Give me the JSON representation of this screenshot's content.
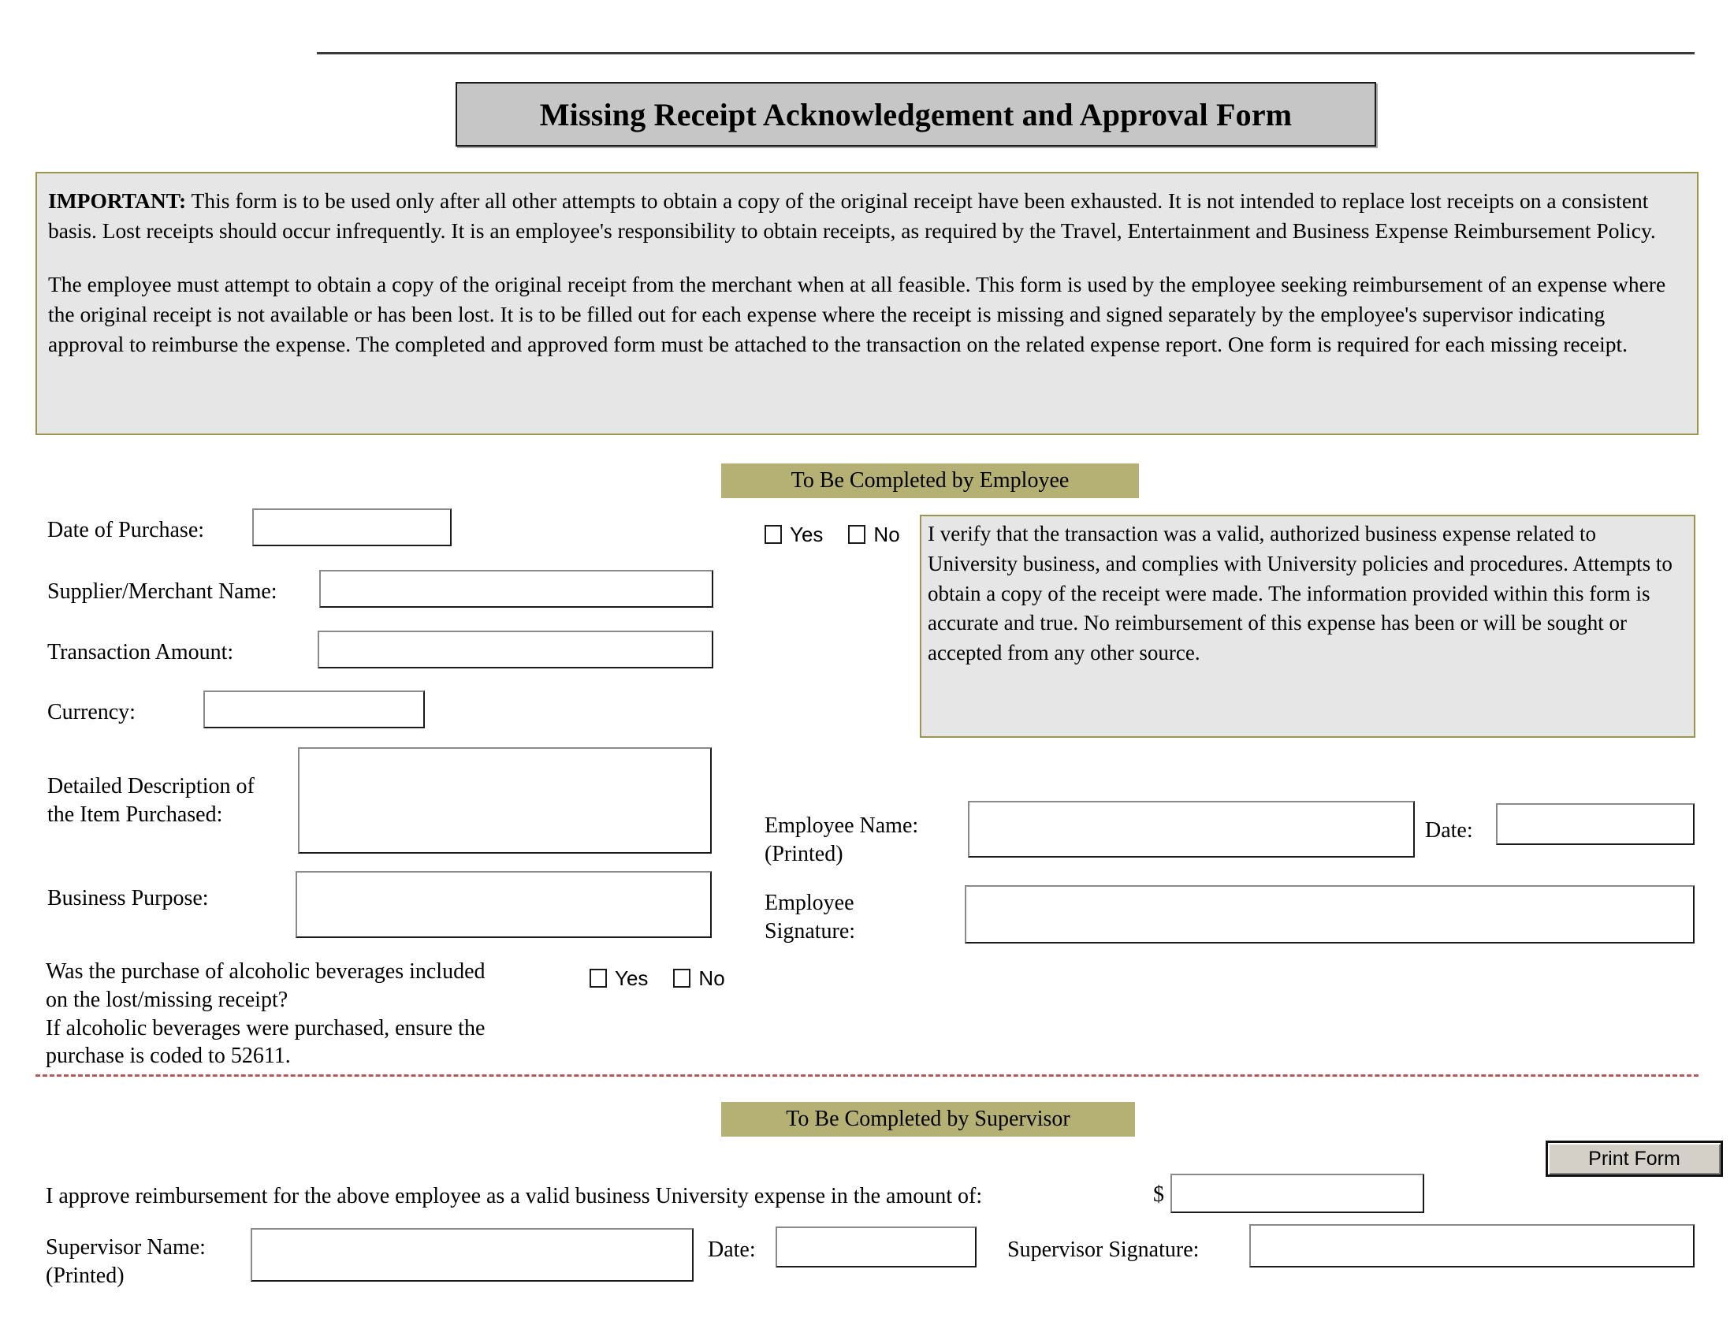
{
  "document": {
    "title": "Missing Receipt Acknowledgement and Approval Form"
  },
  "notice": {
    "lead": "IMPORTANT:",
    "paragraph1": " This form is to be used only after all other attempts to obtain a copy of the original receipt have been exhausted. It is not intended to replace lost receipts on a consistent basis. Lost receipts should occur infrequently. It is an employee's responsibility to obtain receipts, as required by the Travel, Entertainment and Business Expense Reimbursement Policy.",
    "paragraph2": "The employee must attempt to obtain a copy of the original receipt from the merchant when at all feasible.  This form is used by the employee seeking reimbursement of an expense where the original receipt is not available or has been lost.  It is to be filled out for each expense where the receipt is missing and signed separately by the employee's supervisor indicating approval to reimburse the expense.  The completed and approved form must be attached to the transaction on the related expense report.  One form is required for each missing receipt."
  },
  "employee_section": {
    "banner": "To Be Completed by Employee",
    "fields": {
      "date_of_purchase_label": "Date of Purchase:",
      "date_of_purchase_value": "",
      "supplier_label": "Supplier/Merchant Name:",
      "supplier_value": "",
      "transaction_amount_label": "Transaction Amount:",
      "transaction_amount_value": "",
      "currency_label": "Currency:",
      "currency_value": "",
      "detailed_description_label_line1": "Detailed Description of",
      "detailed_description_label_line2": "the Item Purchased:",
      "detailed_description_value": "",
      "business_purpose_label": "Business Purpose:",
      "business_purpose_value": "",
      "employee_name_label_line1": "Employee Name:",
      "employee_name_label_line2": "(Printed)",
      "employee_name_value": "",
      "employee_date_label": "Date:",
      "employee_date_value": "",
      "employee_signature_label_line1": "Employee",
      "employee_signature_label_line2": "Signature:",
      "employee_signature_value": ""
    },
    "verification": {
      "yes_label": "Yes",
      "no_label": "No",
      "statement": "I verify that the transaction was a valid, authorized business expense related to University business, and complies with University policies and procedures. Attempts to obtain a copy of the receipt were made. The information provided within this form is accurate and true. No reimbursement of this expense has been or will be sought or accepted from any other source."
    },
    "alcohol": {
      "question_line1": "Was the purchase of alcoholic beverages included",
      "question_line2": "on the lost/missing receipt?",
      "note_line1": "If alcoholic beverages were purchased, ensure the",
      "note_line2": "purchase is coded to 52611.",
      "yes_label": "Yes",
      "no_label": "No"
    }
  },
  "supervisor_section": {
    "banner": "To Be Completed by Supervisor",
    "approval_statement": "I approve reimbursement for the above employee as a valid business University expense in the amount of:",
    "currency_symbol": "$",
    "amount_value": "",
    "supervisor_name_label_line1": "Supervisor Name:",
    "supervisor_name_label_line2": "(Printed)",
    "supervisor_name_value": "",
    "supervisor_date_label": "Date:",
    "supervisor_date_value": "",
    "supervisor_signature_label": "Supervisor Signature:",
    "supervisor_signature_value": ""
  },
  "actions": {
    "print_form_label": "Print Form"
  },
  "colors": {
    "banner_olive": "#b5b073",
    "notice_border_olive": "#9c9552",
    "notice_fill_gray": "#e6e6e6",
    "title_fill_gray": "#c6c6c6",
    "separator_red": "#b4595c",
    "button_face": "#d4d0c8"
  }
}
